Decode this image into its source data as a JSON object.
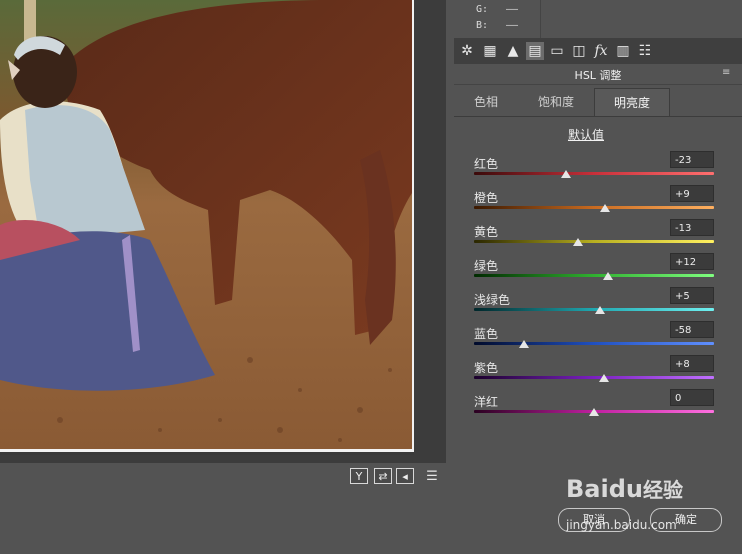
{
  "rgb_readout": {
    "g_label": "G:",
    "g_value": "——",
    "b_label": "B:",
    "b_value": "——"
  },
  "panel_tabs": [
    {
      "icon": "aperture-icon"
    },
    {
      "icon": "grid-icon"
    },
    {
      "icon": "mountains-icon"
    },
    {
      "icon": "hsl-icon"
    },
    {
      "icon": "split-tone-icon"
    },
    {
      "icon": "lens-icon"
    },
    {
      "icon": "fx-icon"
    },
    {
      "icon": "camera-calibration-icon"
    },
    {
      "icon": "presets-icon"
    }
  ],
  "panel": {
    "title": "HSL 调整",
    "menu_icon": "panel-menu-icon"
  },
  "subtabs": [
    {
      "label": "色相",
      "active": false
    },
    {
      "label": "饱和度",
      "active": false
    },
    {
      "label": "明亮度",
      "active": true
    }
  ],
  "default_link": "默认值",
  "sliders": [
    {
      "label": "红色",
      "value": "-23",
      "level": -23,
      "gradient": [
        "#3a0a0a",
        "#c8303a",
        "#ff6f6f"
      ]
    },
    {
      "label": "橙色",
      "value": "+9",
      "level": 9,
      "gradient": [
        "#3a1800",
        "#c86a20",
        "#ffb060"
      ]
    },
    {
      "label": "黄色",
      "value": "-13",
      "level": -13,
      "gradient": [
        "#2a2600",
        "#b8b020",
        "#fff060"
      ]
    },
    {
      "label": "绿色",
      "value": "+12",
      "level": 12,
      "gradient": [
        "#002a00",
        "#30b030",
        "#80ff80"
      ]
    },
    {
      "label": "浅绿色",
      "value": "+5",
      "level": 5,
      "gradient": [
        "#00262a",
        "#20a8b0",
        "#70f0f0"
      ]
    },
    {
      "label": "蓝色",
      "value": "-58",
      "level": -58,
      "gradient": [
        "#000a2a",
        "#2050c0",
        "#6090ff"
      ]
    },
    {
      "label": "紫色",
      "value": "+8",
      "level": 8,
      "gradient": [
        "#1a002a",
        "#7a20c0",
        "#c070ff"
      ]
    },
    {
      "label": "洋红",
      "value": "0",
      "level": 0,
      "gradient": [
        "#2a0020",
        "#c020a0",
        "#ff70e0"
      ]
    }
  ],
  "view_toolbar": {
    "y_label": "Y",
    "swap_icon": "swap-icon",
    "back_icon": "arrow-left-icon",
    "settings_icon": "sliders-icon"
  },
  "footer": {
    "cancel": "取消",
    "ok": "确定"
  },
  "watermark": {
    "brand": "Baidu",
    "brand_cn": "经验",
    "url": "jingyan.baidu.com"
  }
}
